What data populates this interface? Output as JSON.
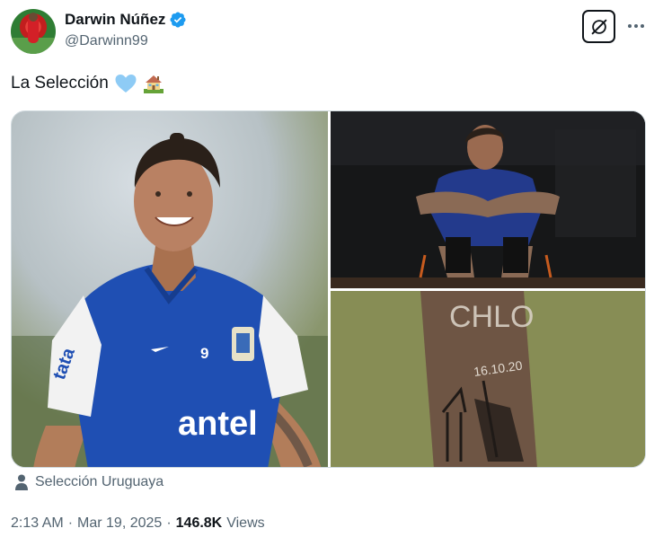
{
  "author": {
    "display_name": "Darwin Núñez",
    "handle": "@Darwinn99",
    "verified": true
  },
  "tweet": {
    "text": "La Selección",
    "emojis": [
      "light-blue-heart",
      "house-with-garden"
    ]
  },
  "media": {
    "images": [
      {
        "alt": "Darwin Núñez smiling in Uruguay training jersey",
        "jersey_text": "antel",
        "number": "9"
      },
      {
        "alt": "Player sitting on a bench in a dark locker room"
      },
      {
        "alt": "Forearm tattoo",
        "tattoo_text": "CHLO",
        "date_text": "16.10.20"
      }
    ]
  },
  "location": {
    "icon": "person-icon",
    "label": "Selección Uruguaya"
  },
  "meta": {
    "time": "2:13 AM",
    "separator": "·",
    "date": "Mar 19, 2025",
    "views_count": "146.8K",
    "views_label": "Views"
  },
  "colors": {
    "primary_text": "#0f1419",
    "secondary_text": "#536471",
    "verified_blue": "#1d9bf0",
    "border": "#cfd9de"
  }
}
